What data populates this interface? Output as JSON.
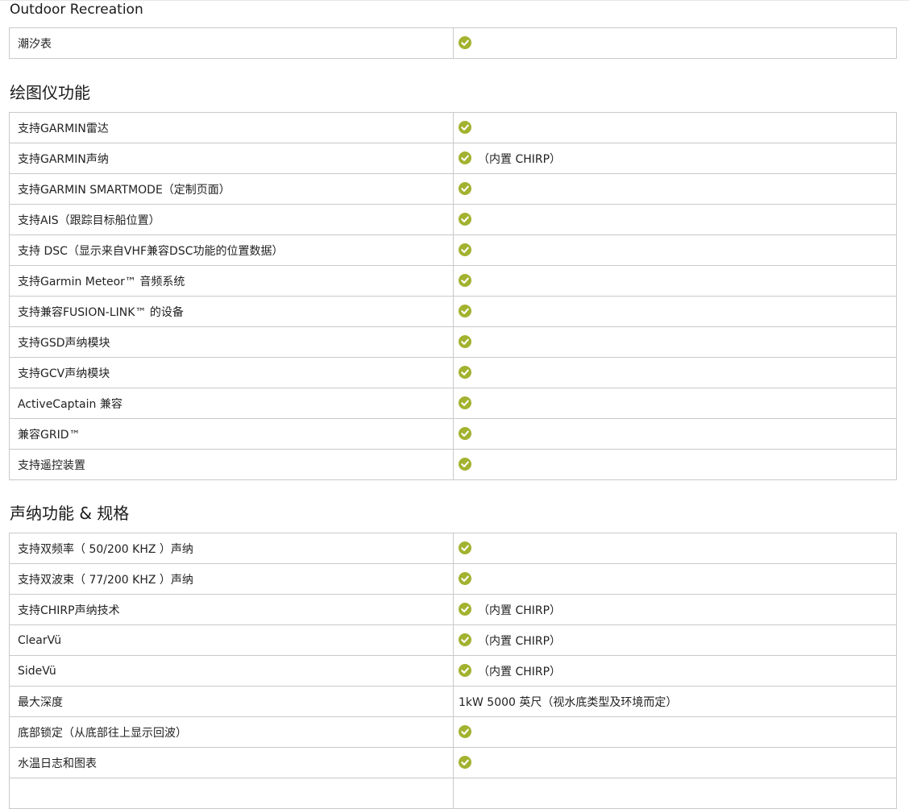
{
  "colors": {
    "check": "#a3b22f",
    "border": "#c9c9c9"
  },
  "sections": [
    {
      "title": "Outdoor Recreation",
      "rows": [
        {
          "feature": "潮汐表",
          "check": true,
          "note": ""
        }
      ]
    },
    {
      "title": "绘图仪功能",
      "rows": [
        {
          "feature": "支持GARMIN雷达",
          "check": true,
          "note": ""
        },
        {
          "feature": "支持GARMIN声纳",
          "check": true,
          "note": "（内置 CHIRP）"
        },
        {
          "feature": "支持GARMIN SMARTMODE（定制页面）",
          "check": true,
          "note": ""
        },
        {
          "feature": "支持AIS（跟踪目标船位置）",
          "check": true,
          "note": ""
        },
        {
          "feature": "支持 DSC（显示来自VHF兼容DSC功能的位置数据）",
          "check": true,
          "note": ""
        },
        {
          "feature": "支持Garmin Meteor™ 音频系统",
          "check": true,
          "note": ""
        },
        {
          "feature": "支持兼容FUSION-LINK™ 的设备",
          "check": true,
          "note": ""
        },
        {
          "feature": "支持GSD声纳模块",
          "check": true,
          "note": ""
        },
        {
          "feature": "支持GCV声纳模块",
          "check": true,
          "note": ""
        },
        {
          "feature": "ActiveCaptain 兼容",
          "check": true,
          "note": ""
        },
        {
          "feature": "兼容GRID™",
          "check": true,
          "note": ""
        },
        {
          "feature": "支持遥控装置",
          "check": true,
          "note": ""
        }
      ]
    },
    {
      "title": "声纳功能 & 规格",
      "rows": [
        {
          "feature": "支持双频率（ 50/200 KHZ ）声纳",
          "check": true,
          "note": ""
        },
        {
          "feature": "支持双波束（ 77/200 KHZ ）声纳",
          "check": true,
          "note": ""
        },
        {
          "feature": "支持CHIRP声纳技术",
          "check": true,
          "note": "（内置 CHIRP）"
        },
        {
          "feature": "ClearVü",
          "check": true,
          "note": "（内置 CHIRP）"
        },
        {
          "feature": "SideVü",
          "check": true,
          "note": "（内置 CHIRP）"
        },
        {
          "feature": "最大深度",
          "check": false,
          "note": "1kW 5000 英尺（视水底类型及环境而定）"
        },
        {
          "feature": "底部锁定（从底部往上显示回波）",
          "check": true,
          "note": ""
        },
        {
          "feature": "水温日志和图表",
          "check": true,
          "note": ""
        },
        {
          "feature": "",
          "check": false,
          "note": ""
        }
      ]
    }
  ]
}
